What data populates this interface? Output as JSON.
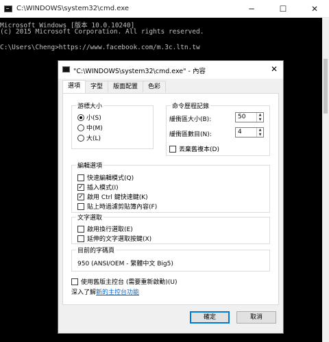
{
  "console": {
    "title": "C:\\WINDOWS\\system32\\cmd.exe",
    "lines": [
      "Microsoft Windows [版本 10.0.10240]",
      "(c) 2015 Microsoft Corporation. All rights reserved.",
      "",
      "C:\\Users\\Cheng>https://www.facebook.com/m.3c.ltn.tw"
    ],
    "controls": {
      "minimize": "─",
      "maximize": "☐",
      "close": "✕"
    }
  },
  "dialog": {
    "title": "\"C:\\WINDOWS\\system32\\cmd.exe\" - 內容",
    "close": "✕",
    "tabs": [
      "選項",
      "字型",
      "版面配置",
      "色彩"
    ],
    "cursor_size": {
      "label": "游標大小",
      "options": [
        {
          "label": "小(S)",
          "selected": true
        },
        {
          "label": "中(M)",
          "selected": false
        },
        {
          "label": "大(L)",
          "selected": false
        }
      ]
    },
    "history": {
      "label": "命令歷程記錄",
      "buffer_size_label": "緩衝區大小(B):",
      "buffer_size_value": "50",
      "buffer_count_label": "緩衝區數目(N):",
      "buffer_count_value": "4",
      "discard_duplicates_label": "丟棄舊複本(D)",
      "discard_duplicates_checked": false
    },
    "edit_options": {
      "label": "編輯選項",
      "items": [
        {
          "label": "快速編輯模式(Q)",
          "checked": false
        },
        {
          "label": "插入模式(I)",
          "checked": true
        },
        {
          "label": "啟用 Ctrl 鍵快速鍵(K)",
          "checked": true
        },
        {
          "label": "貼上時過濾剪貼簿內容(F)",
          "checked": false
        }
      ]
    },
    "text_selection": {
      "label": "文字選取",
      "items": [
        {
          "label": "啟用換行選取(E)",
          "checked": false
        },
        {
          "label": "延伸的文字選取按鍵(X)",
          "checked": false
        }
      ]
    },
    "codepage": {
      "label": "目前的字碼頁",
      "value": "950  (ANSI/OEM - 繁體中文 Big5)"
    },
    "legacy_console_label": "使用舊版主控台 (需要重新啟動)(U)",
    "learn_more_prefix": "深入了解",
    "learn_more_link": "新的主控台功能",
    "ok_label": "確定",
    "cancel_label": "取消"
  }
}
